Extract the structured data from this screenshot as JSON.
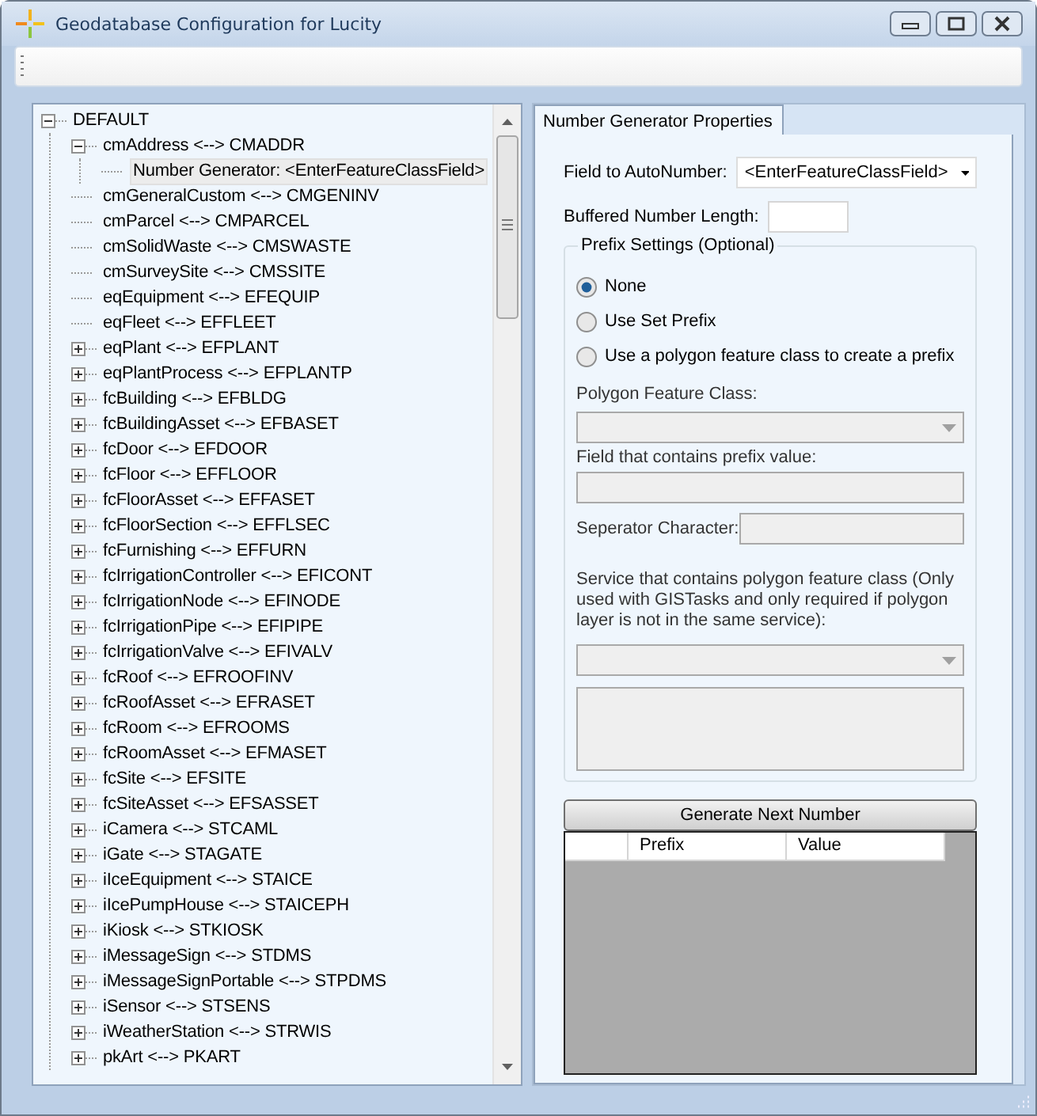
{
  "window": {
    "title": "Geodatabase Configuration for Lucity"
  },
  "tree": [
    {
      "label": "DEFAULT",
      "expanded": true,
      "selected": false,
      "children": [
        {
          "label": "cmAddress <--> CMADDR",
          "expanded": true,
          "selected": false,
          "children": [
            {
              "label": "Number Generator: <EnterFeatureClassField>",
              "selected": true
            }
          ]
        },
        {
          "label": "cmGeneralCustom <--> CMGENINV",
          "selected": false
        },
        {
          "label": "cmParcel <--> CMPARCEL",
          "selected": false
        },
        {
          "label": "cmSolidWaste <--> CMSWASTE",
          "selected": false
        },
        {
          "label": "cmSurveySite <--> CMSSITE",
          "selected": false
        },
        {
          "label": "eqEquipment <--> EFEQUIP",
          "selected": false
        },
        {
          "label": "eqFleet <--> EFFLEET",
          "selected": false
        },
        {
          "label": "eqPlant <--> EFPLANT",
          "expanded": false,
          "selected": false
        },
        {
          "label": "eqPlantProcess <--> EFPLANTP",
          "expanded": false,
          "selected": false
        },
        {
          "label": "fcBuilding <--> EFBLDG",
          "expanded": false,
          "selected": false
        },
        {
          "label": "fcBuildingAsset <--> EFBASET",
          "expanded": false,
          "selected": false
        },
        {
          "label": "fcDoor <--> EFDOOR",
          "expanded": false,
          "selected": false
        },
        {
          "label": "fcFloor <--> EFFLOOR",
          "expanded": false,
          "selected": false
        },
        {
          "label": "fcFloorAsset <--> EFFASET",
          "expanded": false,
          "selected": false
        },
        {
          "label": "fcFloorSection <--> EFFLSEC",
          "expanded": false,
          "selected": false
        },
        {
          "label": "fcFurnishing <--> EFFURN",
          "expanded": false,
          "selected": false
        },
        {
          "label": "fcIrrigationController <--> EFICONT",
          "expanded": false,
          "selected": false
        },
        {
          "label": "fcIrrigationNode <--> EFINODE",
          "expanded": false,
          "selected": false
        },
        {
          "label": "fcIrrigationPipe <--> EFIPIPE",
          "expanded": false,
          "selected": false
        },
        {
          "label": "fcIrrigationValve <--> EFIVALV",
          "expanded": false,
          "selected": false
        },
        {
          "label": "fcRoof <--> EFROOFINV",
          "expanded": false,
          "selected": false
        },
        {
          "label": "fcRoofAsset <--> EFRASET",
          "expanded": false,
          "selected": false
        },
        {
          "label": "fcRoom <--> EFROOMS",
          "expanded": false,
          "selected": false
        },
        {
          "label": "fcRoomAsset <--> EFMASET",
          "expanded": false,
          "selected": false
        },
        {
          "label": "fcSite <--> EFSITE",
          "expanded": false,
          "selected": false
        },
        {
          "label": "fcSiteAsset <--> EFSASSET",
          "expanded": false,
          "selected": false
        },
        {
          "label": "iCamera <--> STCAML",
          "expanded": false,
          "selected": false
        },
        {
          "label": "iGate <--> STAGATE",
          "expanded": false,
          "selected": false
        },
        {
          "label": "iIceEquipment <--> STAICE",
          "expanded": false,
          "selected": false
        },
        {
          "label": "iIcePumpHouse <--> STAICEPH",
          "expanded": false,
          "selected": false
        },
        {
          "label": "iKiosk <--> STKIOSK",
          "expanded": false,
          "selected": false
        },
        {
          "label": "iMessageSign <--> STDMS",
          "expanded": false,
          "selected": false
        },
        {
          "label": "iMessageSignPortable <--> STPDMS",
          "expanded": false,
          "selected": false
        },
        {
          "label": "iSensor <--> STSENS",
          "expanded": false,
          "selected": false
        },
        {
          "label": "iWeatherStation <--> STRWIS",
          "expanded": false,
          "selected": false
        },
        {
          "label": "pkArt <--> PKART",
          "expanded": false,
          "selected": false
        }
      ]
    }
  ],
  "tab": {
    "label": "Number Generator Properties",
    "selected": true
  },
  "form": {
    "field_to_autonumber": {
      "label": "Field to AutoNumber:",
      "value": "<EnterFeatureClassField>"
    },
    "buffered_number_length": {
      "label": "Buffered Number Length:"
    },
    "prefix_settings": {
      "title": "Prefix Settings (Optional)",
      "options": [
        {
          "label": "None",
          "selected": true
        },
        {
          "label": "Use Set Prefix",
          "selected": false
        },
        {
          "label": "Use a polygon feature class to create a prefix",
          "selected": false
        }
      ],
      "polygon_feature_class": {
        "label": "Polygon Feature Class:",
        "disabled": true
      },
      "prefix_field": {
        "label": "Field that contains prefix value:",
        "disabled": true
      },
      "separator": {
        "label": "Seperator Character:",
        "disabled": true
      },
      "service": {
        "label": "Service that contains polygon feature class (Only used with GISTasks and only required if polygon layer is not in the same service):",
        "disabled": true
      },
      "service_list": {
        "disabled": true
      }
    },
    "generate_button": "Generate Next Number",
    "grid": {
      "columns": [
        "Prefix",
        "Value"
      ]
    }
  }
}
